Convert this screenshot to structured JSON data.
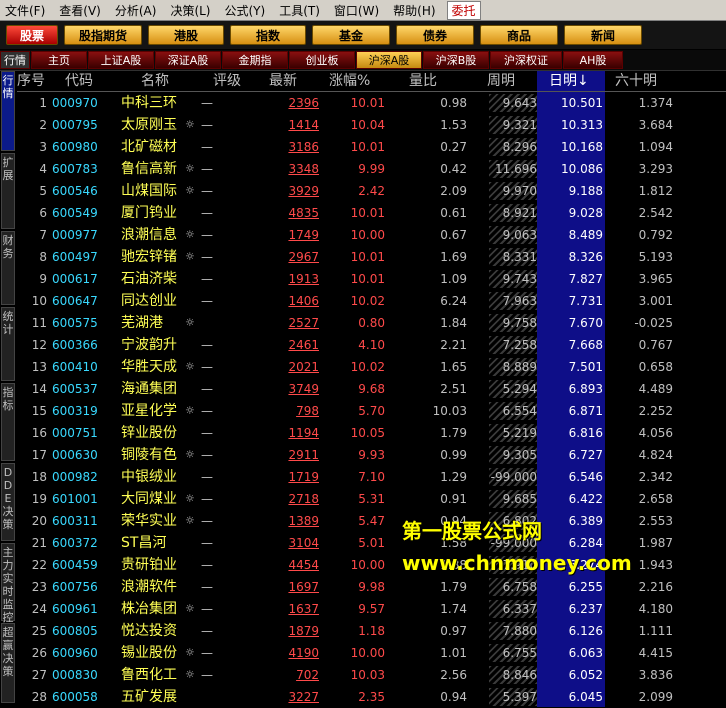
{
  "menu": [
    "文件(F)",
    "查看(V)",
    "分析(A)",
    "决策(L)",
    "公式(Y)",
    "工具(T)",
    "窗口(W)",
    "帮助(H)",
    "委托"
  ],
  "buttons": [
    "股票",
    "股指期货",
    "港股",
    "指数",
    "基金",
    "债券",
    "商品",
    "新闻"
  ],
  "tabs": [
    "行情",
    "主页",
    "上证A股",
    "深证A股",
    "金期指",
    "创业板",
    "沪深A股",
    "沪深B股",
    "沪深权证",
    "AH股"
  ],
  "side_tabs": [
    "行情",
    "扩展",
    "财务",
    "统计",
    "指标",
    "DDE决策",
    "主力实时监控",
    "超赢决策"
  ],
  "columns": [
    "序号",
    "代码",
    "名称",
    "评级",
    "最新",
    "涨幅%",
    "量比",
    "周明",
    "日明↓",
    "六十明"
  ],
  "rows": [
    {
      "i": "1",
      "code": "000970",
      "name": "中科三环",
      "mark": "",
      "rate": "—",
      "price": "2396",
      "chg": "10.01",
      "vr": "0.98",
      "wk": "9.643",
      "dm": "10.501",
      "s60": "1.374"
    },
    {
      "i": "2",
      "code": "000795",
      "name": "太原刚玉",
      "mark": "☼",
      "rate": "—",
      "price": "1414",
      "chg": "10.04",
      "vr": "1.53",
      "wk": "9.321",
      "dm": "10.313",
      "s60": "3.684"
    },
    {
      "i": "3",
      "code": "600980",
      "name": "北矿磁材",
      "mark": "",
      "rate": "—",
      "price": "3186",
      "chg": "10.01",
      "vr": "0.27",
      "wk": "8.296",
      "dm": "10.168",
      "s60": "1.094"
    },
    {
      "i": "4",
      "code": "600783",
      "name": "鲁信高新",
      "mark": "☼",
      "rate": "—",
      "price": "3348",
      "chg": "9.99",
      "vr": "0.42",
      "wk": "11.696",
      "dm": "10.086",
      "s60": "3.293"
    },
    {
      "i": "5",
      "code": "600546",
      "name": "山煤国际",
      "mark": "☼",
      "rate": "—",
      "price": "3929",
      "chg": "2.42",
      "vr": "2.09",
      "wk": "9.970",
      "dm": "9.188",
      "s60": "1.812"
    },
    {
      "i": "6",
      "code": "600549",
      "name": "厦门钨业",
      "mark": "",
      "rate": "—",
      "price": "4835",
      "chg": "10.01",
      "vr": "0.61",
      "wk": "8.921",
      "dm": "9.028",
      "s60": "2.542"
    },
    {
      "i": "7",
      "code": "000977",
      "name": "浪潮信息",
      "mark": "☼",
      "rate": "—",
      "price": "1749",
      "chg": "10.00",
      "vr": "0.67",
      "wk": "9.063",
      "dm": "8.489",
      "s60": "0.792"
    },
    {
      "i": "8",
      "code": "600497",
      "name": "驰宏锌锗",
      "mark": "☼",
      "rate": "—",
      "price": "2967",
      "chg": "10.01",
      "vr": "1.69",
      "wk": "8.331",
      "dm": "8.326",
      "s60": "5.193"
    },
    {
      "i": "9",
      "code": "000617",
      "name": "石油济柴",
      "mark": "",
      "rate": "—",
      "price": "1913",
      "chg": "10.01",
      "vr": "1.09",
      "wk": "9.743",
      "dm": "7.827",
      "s60": "3.965"
    },
    {
      "i": "10",
      "code": "600647",
      "name": "同达创业",
      "mark": "",
      "rate": "—",
      "price": "1406",
      "chg": "10.02",
      "vr": "6.24",
      "wk": "7.963",
      "dm": "7.731",
      "s60": "3.001"
    },
    {
      "i": "11",
      "code": "600575",
      "name": "芜湖港",
      "mark": "☼",
      "rate": "",
      "price": "2527",
      "chg": "0.80",
      "vr": "1.84",
      "wk": "9.758",
      "dm": "7.670",
      "s60": "-0.025"
    },
    {
      "i": "12",
      "code": "600366",
      "name": "宁波韵升",
      "mark": "",
      "rate": "—",
      "price": "2461",
      "chg": "4.10",
      "vr": "2.21",
      "wk": "7.258",
      "dm": "7.668",
      "s60": "0.767"
    },
    {
      "i": "13",
      "code": "600410",
      "name": "华胜天成",
      "mark": "☼",
      "rate": "—",
      "price": "2021",
      "chg": "10.02",
      "vr": "1.65",
      "wk": "8.889",
      "dm": "7.501",
      "s60": "0.658"
    },
    {
      "i": "14",
      "code": "600537",
      "name": "海通集团",
      "mark": "",
      "rate": "—",
      "price": "3749",
      "chg": "9.68",
      "vr": "2.51",
      "wk": "5.294",
      "dm": "6.893",
      "s60": "4.489"
    },
    {
      "i": "15",
      "code": "600319",
      "name": "亚星化学",
      "mark": "☼",
      "rate": "—",
      "price": "798",
      "chg": "5.70",
      "vr": "10.03",
      "wk": "6.554",
      "dm": "6.871",
      "s60": "2.252"
    },
    {
      "i": "16",
      "code": "000751",
      "name": "锌业股份",
      "mark": "",
      "rate": "—",
      "price": "1194",
      "chg": "10.05",
      "vr": "1.79",
      "wk": "5.219",
      "dm": "6.816",
      "s60": "4.056"
    },
    {
      "i": "17",
      "code": "000630",
      "name": "铜陵有色",
      "mark": "☼",
      "rate": "—",
      "price": "2911",
      "chg": "9.93",
      "vr": "0.99",
      "wk": "9.305",
      "dm": "6.727",
      "s60": "4.824"
    },
    {
      "i": "18",
      "code": "000982",
      "name": "中银绒业",
      "mark": "",
      "rate": "—",
      "price": "1719",
      "chg": "7.10",
      "vr": "1.29",
      "wk": "-99.000",
      "dm": "6.546",
      "s60": "2.342"
    },
    {
      "i": "19",
      "code": "601001",
      "name": "大同煤业",
      "mark": "☼",
      "rate": "—",
      "price": "2718",
      "chg": "5.31",
      "vr": "0.91",
      "wk": "9.685",
      "dm": "6.422",
      "s60": "2.658"
    },
    {
      "i": "20",
      "code": "600311",
      "name": "荣华实业",
      "mark": "☼",
      "rate": "—",
      "price": "1389",
      "chg": "5.47",
      "vr": "0.94",
      "wk": "6.802",
      "dm": "6.389",
      "s60": "2.553"
    },
    {
      "i": "21",
      "code": "600372",
      "name": "ST昌河",
      "mark": "",
      "rate": "—",
      "price": "3104",
      "chg": "5.01",
      "vr": "1.58",
      "wk": "-99.000",
      "dm": "6.284",
      "s60": "1.987"
    },
    {
      "i": "22",
      "code": "600459",
      "name": "贵研铂业",
      "mark": "",
      "rate": "—",
      "price": "4454",
      "chg": "10.00",
      "vr": "1.88",
      "wk": "7.910",
      "dm": "6.274",
      "s60": "1.943"
    },
    {
      "i": "23",
      "code": "600756",
      "name": "浪潮软件",
      "mark": "",
      "rate": "—",
      "price": "1697",
      "chg": "9.98",
      "vr": "1.79",
      "wk": "6.758",
      "dm": "6.255",
      "s60": "2.216"
    },
    {
      "i": "24",
      "code": "600961",
      "name": "株冶集团",
      "mark": "☼",
      "rate": "—",
      "price": "1637",
      "chg": "9.57",
      "vr": "1.74",
      "wk": "6.337",
      "dm": "6.237",
      "s60": "4.180"
    },
    {
      "i": "25",
      "code": "600805",
      "name": "悦达投资",
      "mark": "",
      "rate": "—",
      "price": "1879",
      "chg": "1.18",
      "vr": "0.97",
      "wk": "7.880",
      "dm": "6.126",
      "s60": "1.111"
    },
    {
      "i": "26",
      "code": "600960",
      "name": "锡业股份",
      "mark": "☼",
      "rate": "—",
      "price": "4190",
      "chg": "10.00",
      "vr": "1.01",
      "wk": "6.755",
      "dm": "6.063",
      "s60": "4.415"
    },
    {
      "i": "27",
      "code": "000830",
      "name": "鲁西化工",
      "mark": "☼",
      "rate": "—",
      "price": "702",
      "chg": "10.03",
      "vr": "2.56",
      "wk": "8.846",
      "dm": "6.052",
      "s60": "3.836"
    },
    {
      "i": "28",
      "code": "600058",
      "name": "五矿发展",
      "mark": "",
      "rate": "",
      "price": "3227",
      "chg": "2.35",
      "vr": "0.94",
      "wk": "5.397",
      "dm": "6.045",
      "s60": "2.099"
    }
  ],
  "watermark": {
    "line1": "第一股票公式网",
    "line2": "www.chnmoney.com"
  }
}
